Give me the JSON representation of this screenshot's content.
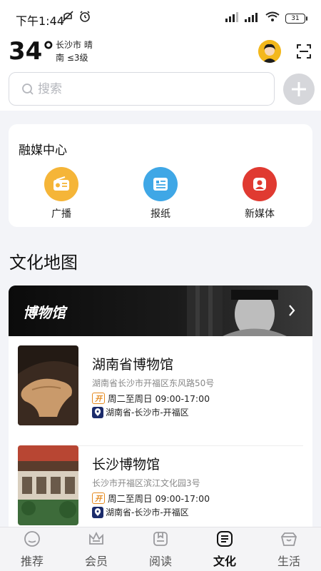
{
  "status_bar": {
    "time": "下午1:44",
    "battery": "31"
  },
  "weather": {
    "temperature": "34°",
    "city_condition": "长沙市 晴",
    "wind": "南 ≤3级"
  },
  "search": {
    "placeholder": "搜索"
  },
  "media_center": {
    "title": "融媒中心",
    "items": [
      {
        "label": "广播",
        "icon": "radio-icon",
        "color": "#f5b538"
      },
      {
        "label": "报纸",
        "icon": "newspaper-icon",
        "color": "#3fa7e6"
      },
      {
        "label": "新媒体",
        "icon": "new-media-icon",
        "color": "#e03a31"
      }
    ]
  },
  "culture_map": {
    "title": "文化地图",
    "banner_label": "博物馆",
    "museums": [
      {
        "name": "湖南省博物馆",
        "address": "湖南省长沙市开福区东风路50号",
        "hours": "周二至周日 09:00-17:00",
        "region": "湖南省-长沙市-开福区"
      },
      {
        "name": "长沙博物馆",
        "address": "长沙市开福区滨江文化园3号",
        "hours": "周二至周日 09:00-17:00",
        "region": "湖南省-长沙市-开福区"
      }
    ]
  },
  "tabs": [
    {
      "label": "推荐",
      "icon": "recommend-icon"
    },
    {
      "label": "会员",
      "icon": "crown-icon"
    },
    {
      "label": "阅读",
      "icon": "book-icon"
    },
    {
      "label": "文化",
      "icon": "culture-icon",
      "active": true
    },
    {
      "label": "生活",
      "icon": "life-icon"
    }
  ]
}
